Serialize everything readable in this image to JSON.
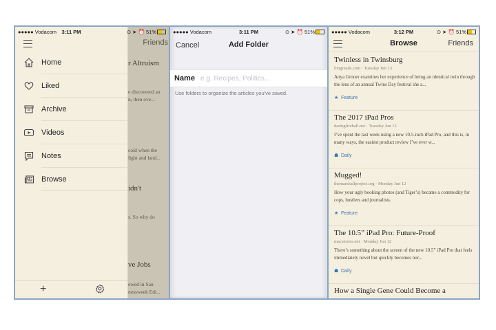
{
  "panel1": {
    "status": {
      "carrier": "●●●●● Vodacom",
      "time": "3:11 PM",
      "battery": "51%"
    },
    "underlay": {
      "friends": "Friends",
      "title1": "r Altruism",
      "snip1a": "e discovered an",
      "snip1b": "n, then ove...",
      "snip2a": "cold when the",
      "snip2b": "light and land...",
      "title2": "idn't",
      "snip3": "s. So why do",
      "title3": "ve Jobs",
      "snip4a": "ewed in San",
      "snip4b": "nessweek Edi..."
    },
    "menu": [
      {
        "label": "Home",
        "icon": "home-icon"
      },
      {
        "label": "Liked",
        "icon": "heart-icon"
      },
      {
        "label": "Archive",
        "icon": "archive-icon"
      },
      {
        "label": "Videos",
        "icon": "video-icon"
      },
      {
        "label": "Notes",
        "icon": "notes-icon"
      },
      {
        "label": "Browse",
        "icon": "newspaper-icon"
      }
    ],
    "footer": {
      "plus": "+",
      "gear": "gear-icon"
    }
  },
  "panel2": {
    "status": {
      "carrier": "●●●●● Vodacom",
      "time": "3:11 PM",
      "battery": "51%"
    },
    "cancel": "Cancel",
    "title": "Add Folder",
    "name_label": "Name",
    "name_placeholder": "e.g. Recipes, Politics...",
    "name_value": "",
    "help": "Use folders to organize the articles you've saved."
  },
  "panel3": {
    "status": {
      "carrier": "●●●●● Vodacom",
      "time": "3:12 PM",
      "battery": "51%"
    },
    "title": "Browse",
    "friends": "Friends",
    "articles": [
      {
        "title": "Twinless in Twinsburg",
        "meta": "longreads.com · Tuesday Jun 13",
        "excerpt": "Anya Groner examines her experience of being an identical twin through the lens of an annual Twins Day festival she a...",
        "tag": "Feature"
      },
      {
        "title": "The 2017 iPad Pros",
        "meta": "daringfireball.net · Tuesday Jun 13",
        "excerpt": "I’ve spent the last week using a new 10.5-inch iPad Pro, and this is, in many ways, the easiest product review I’ve ever w...",
        "tag": "Daily"
      },
      {
        "title": "Mugged!",
        "meta": "themarshallproject.org · Monday Jun 12",
        "excerpt": "How your ugly booking photos (and Tiger’s) became a commodity for cops, hustlers and journalists.",
        "tag": "Feature"
      },
      {
        "title": "The 10.5” iPad Pro: Future-Proof",
        "meta": "macstories.net · Monday Jun 12",
        "excerpt": "There’s something about the screen of the new 10.5” iPad Pro that feels immediately novel but quickly becomes nor...",
        "tag": "Daily"
      },
      {
        "title": "How a Single Gene Could Become a",
        "meta": "",
        "excerpt": "",
        "tag": ""
      }
    ]
  },
  "colors": {
    "accent": "#3e76b4",
    "paper": "#f4efdf",
    "form_bg": "#efeff4"
  }
}
